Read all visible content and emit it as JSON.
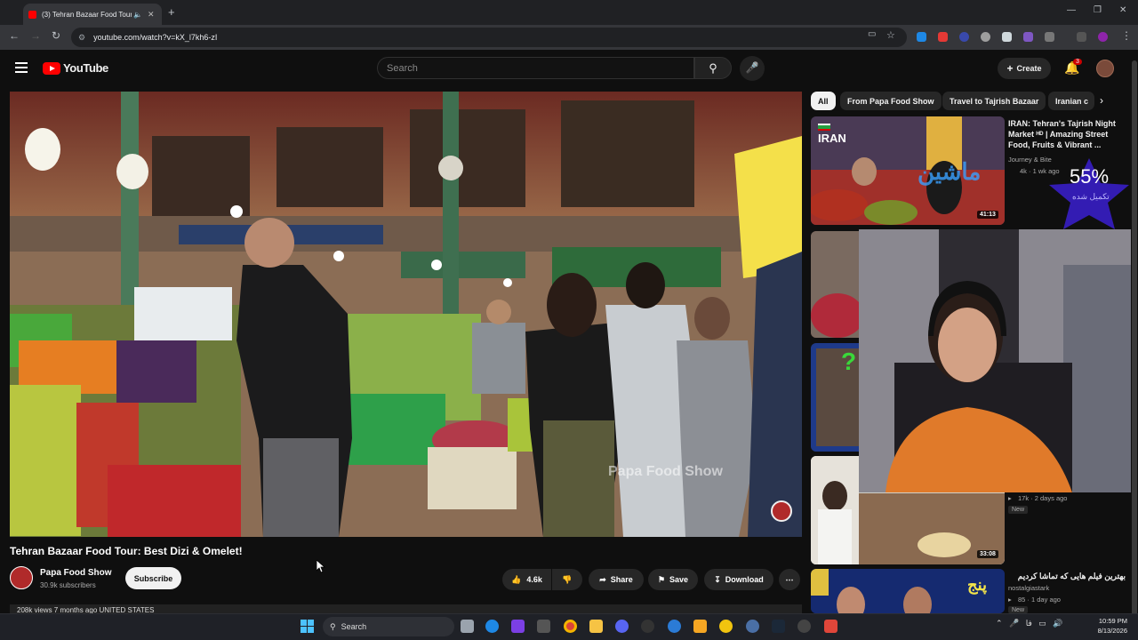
{
  "browser": {
    "tab_title": "(3) Tehran Bazaar Food Tour: Best...",
    "url": "youtube.com/watch?v=kX_l7kh6-zI"
  },
  "header": {
    "logo_text": "YouTube",
    "search_placeholder": "Search",
    "create_label": "Create",
    "notification_count": "3"
  },
  "video": {
    "title": "Tehran Bazaar Food Tour: Best Dizi & Omelet!",
    "watermark": "Papa Food Show",
    "channel_name": "Papa Food Show",
    "subscribers": "30.9k subscribers",
    "subscribe_label": "Subscribe",
    "likes": "4.6k",
    "share_label": "Share",
    "save_label": "Save",
    "download_label": "Download",
    "views_line": "208k views  7 months ago  UNITED STATES"
  },
  "chips": [
    "All",
    "From Papa Food Show",
    "Travel to Tajrish Bazaar",
    "Iranian c"
  ],
  "recommended": [
    {
      "title": "IRAN: Tehran's Tajrish Night Market ᴴᴰ | Amazing Street Food, Fruits & Vibrant ...",
      "channel": "Journey & Bite",
      "meta": "4k · 1 wk ago",
      "duration": "41:13",
      "thumb_label": "IRAN"
    },
    {
      "title": "",
      "channel": "",
      "meta": "17k · 2 days ago",
      "badge": "New",
      "duration": "33:08"
    },
    {
      "title": "بهترین فیلم هایی که تماشا کردیم",
      "channel": "nostalgiastark",
      "meta": "85 · 1 day ago",
      "badge": "New",
      "thumb_label": "پنج"
    }
  ],
  "overlay": {
    "percent": "55%",
    "caption": "تکمیل شده",
    "progress": 0.55
  },
  "taskbar": {
    "search_label": "Search",
    "time": "10:59 PM",
    "date": "8/13/2026"
  }
}
